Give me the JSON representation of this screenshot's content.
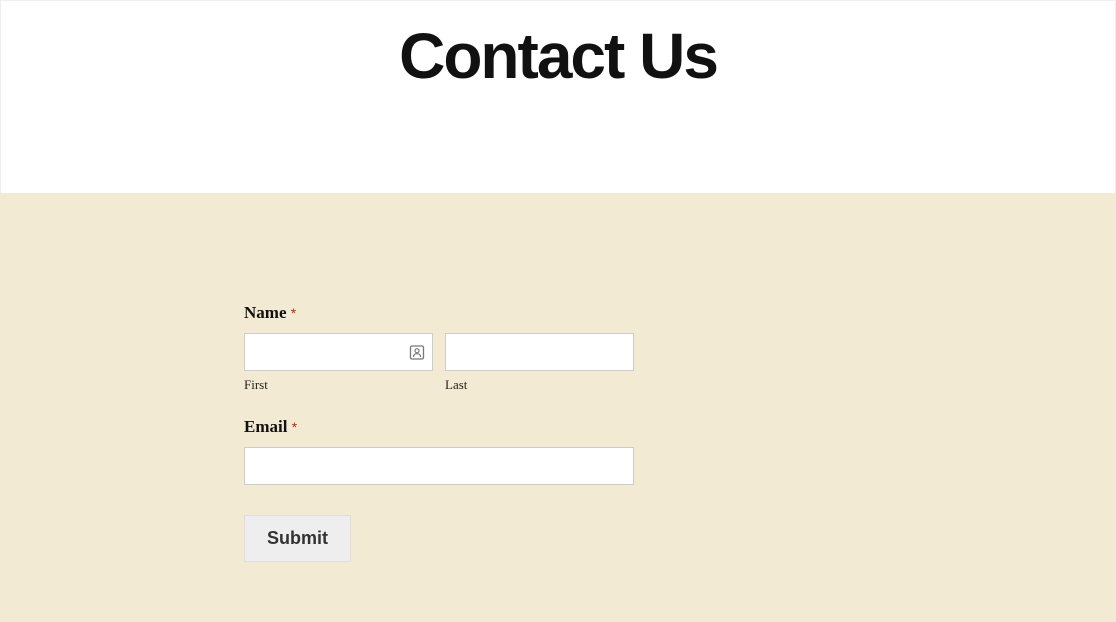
{
  "header": {
    "title": "Contact Us"
  },
  "form": {
    "name": {
      "label": "Name",
      "required_marker": "*",
      "first": {
        "value": "",
        "sublabel": "First"
      },
      "last": {
        "value": "",
        "sublabel": "Last"
      }
    },
    "email": {
      "label": "Email",
      "required_marker": "*",
      "value": ""
    },
    "submit_label": "Submit"
  }
}
